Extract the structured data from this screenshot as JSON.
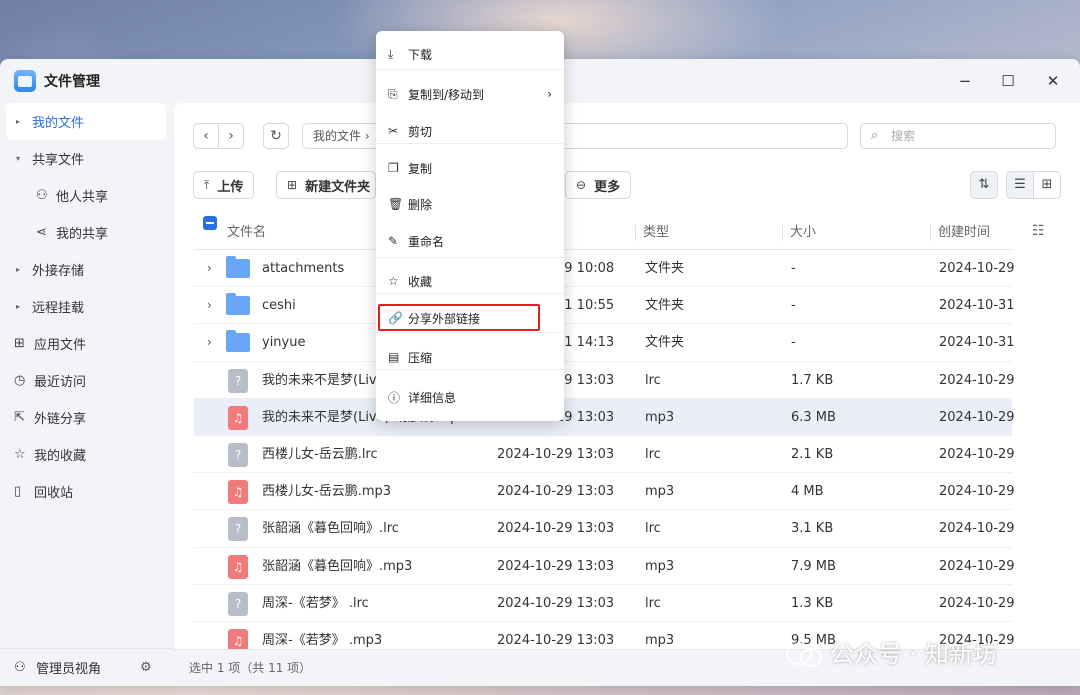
{
  "window": {
    "title": "文件管理",
    "minimize": "−",
    "maximize": "☐",
    "close": "✕"
  },
  "sidebar": {
    "items": [
      {
        "label": "我的文件",
        "caret": "▸",
        "active": true
      },
      {
        "label": "共享文件",
        "caret": "▾"
      },
      {
        "label": "他人共享",
        "icon": "people-icon"
      },
      {
        "label": "我的共享",
        "icon": "share-icon"
      },
      {
        "label": "外接存储",
        "caret": "▸"
      },
      {
        "label": "远程挂载",
        "caret": "▸"
      },
      {
        "label": "应用文件",
        "icon": "apps-icon"
      },
      {
        "label": "最近访问",
        "icon": "clock-icon"
      },
      {
        "label": "外链分享",
        "icon": "external-link-icon"
      },
      {
        "label": "我的收藏",
        "icon": "star-icon"
      },
      {
        "label": "回收站",
        "icon": "trash-icon"
      }
    ],
    "footer": {
      "label": "管理员视角",
      "icon": "admin-icon",
      "settings_icon": "gear-icon"
    }
  },
  "toolbar": {
    "back": "‹",
    "forward": "›",
    "refresh": "↻",
    "breadcrumb": "我的文件 ›",
    "search_placeholder": "搜索",
    "upload": "上传",
    "new_folder": "新建文件夹",
    "more": "更多",
    "sort_icon": "sort-icon",
    "list_view_icon": "list-view-icon",
    "grid_view_icon": "grid-view-icon"
  },
  "table": {
    "headers": {
      "name": "文件名",
      "type": "类型",
      "size": "大小",
      "created": "创建时间"
    },
    "rows": [
      {
        "name": "attachments",
        "modified": "2024-10-29 10:08",
        "type": "文件夹",
        "size": "-",
        "created": "2024-10-29",
        "kind": "folder"
      },
      {
        "name": "ceshi",
        "modified": "2024-10-31 10:55",
        "type": "文件夹",
        "size": "-",
        "created": "2024-10-31",
        "kind": "folder"
      },
      {
        "name": "yinyue",
        "modified": "2024-10-31 14:13",
        "type": "文件夹",
        "size": "-",
        "created": "2024-10-31",
        "kind": "folder"
      },
      {
        "name": "我的未来不是梦(Live)-胡彦斌.lrc",
        "modified": "2024-10-29 13:03",
        "type": "lrc",
        "size": "1.7 KB",
        "created": "2024-10-29",
        "kind": "lrc"
      },
      {
        "name": "我的未来不是梦(Live)-胡彦斌.mp3",
        "modified": "2024-10-29 13:03",
        "type": "mp3",
        "size": "6.3 MB",
        "created": "2024-10-29",
        "kind": "mp3",
        "selected": true
      },
      {
        "name": "西楼儿女-岳云鹏.lrc",
        "modified": "2024-10-29 13:03",
        "type": "lrc",
        "size": "2.1 KB",
        "created": "2024-10-29",
        "kind": "lrc"
      },
      {
        "name": "西楼儿女-岳云鹏.mp3",
        "modified": "2024-10-29 13:03",
        "type": "mp3",
        "size": "4 MB",
        "created": "2024-10-29",
        "kind": "mp3"
      },
      {
        "name": "张韶涵《暮色回响》.lrc",
        "modified": "2024-10-29 13:03",
        "type": "lrc",
        "size": "3.1 KB",
        "created": "2024-10-29",
        "kind": "lrc"
      },
      {
        "name": "张韶涵《暮色回响》.mp3",
        "modified": "2024-10-29 13:03",
        "type": "mp3",
        "size": "7.9 MB",
        "created": "2024-10-29",
        "kind": "mp3"
      },
      {
        "name": "周深-《若梦》 .lrc",
        "modified": "2024-10-29 13:03",
        "type": "lrc",
        "size": "1.3 KB",
        "created": "2024-10-29",
        "kind": "lrc"
      },
      {
        "name": "周深-《若梦》 .mp3",
        "modified": "2024-10-29 13:03",
        "type": "mp3",
        "size": "9.5 MB",
        "created": "2024-10-29",
        "kind": "mp3"
      }
    ]
  },
  "status": "选中 1 项（共 11 项）",
  "context_menu": {
    "items": [
      {
        "label": "下载",
        "icon": "download-icon",
        "glyph": "⤓"
      },
      {
        "label": "复制到/移动到",
        "icon": "copy-move-icon",
        "glyph": "⎘",
        "submenu": "›"
      },
      {
        "label": "剪切",
        "icon": "scissors-icon",
        "glyph": "✂"
      },
      {
        "label": "复制",
        "icon": "copy-icon",
        "glyph": "❐"
      },
      {
        "label": "删除",
        "icon": "trash-icon",
        "glyph": "🗑"
      },
      {
        "label": "重命名",
        "icon": "pencil-icon",
        "glyph": "✎"
      },
      {
        "label": "收藏",
        "icon": "star-icon",
        "glyph": "☆"
      },
      {
        "label": "分享外部链接",
        "icon": "link-icon",
        "glyph": "🔗",
        "highlighted": true
      },
      {
        "label": "压缩",
        "icon": "archive-icon",
        "glyph": "▤"
      },
      {
        "label": "详细信息",
        "icon": "info-icon",
        "glyph": "ⓘ"
      }
    ]
  },
  "watermark": {
    "text": "公众号 · 知新坊"
  },
  "colors": {
    "accent": "#2a6fe0",
    "folder": "#6aa6f6",
    "mp3": "#f07b7b",
    "lrc": "#b8bec8",
    "highlight_border": "#e02020"
  }
}
